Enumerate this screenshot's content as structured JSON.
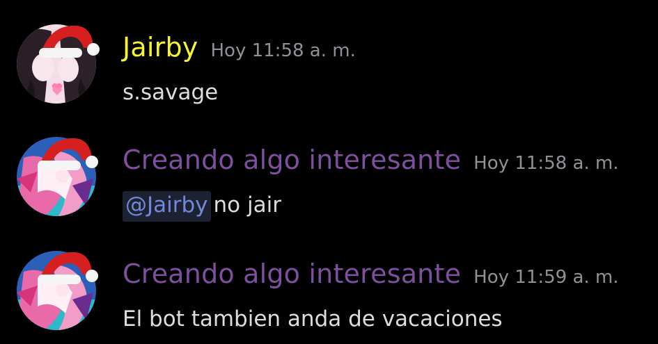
{
  "colors": {
    "background": "#000000",
    "message_text": "#dcddde",
    "timestamp": "#8e9297",
    "mention_text": "#7289da",
    "mention_bg": "#1d2233"
  },
  "messages": [
    {
      "author": "Jairby",
      "author_color": "#f6f62e",
      "timestamp": "Hoy 11:58 a. m.",
      "avatar_icon": "anime-couple-santa-hat-avatar",
      "mention": "",
      "text": "s.savage"
    },
    {
      "author": "Creando algo interesante",
      "author_color": "#7d4f9e",
      "timestamp": "Hoy 11:58 a. m.",
      "avatar_icon": "anime-girl-santa-hat-avatar",
      "mention": "@Jairby",
      "text": "no jair"
    },
    {
      "author": "Creando algo interesante",
      "author_color": "#7d4f9e",
      "timestamp": "Hoy 11:59 a. m.",
      "avatar_icon": "anime-girl-santa-hat-avatar",
      "mention": "",
      "text": "El bot tambien anda de vacaciones"
    }
  ]
}
